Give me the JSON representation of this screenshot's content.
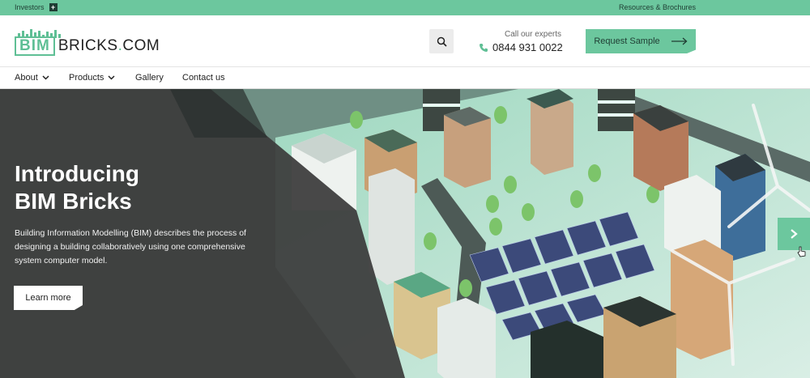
{
  "topbar": {
    "investors_label": "Investors",
    "resources_label": "Resources & Brochures"
  },
  "header": {
    "logo_bim": "BIM",
    "logo_bricks": "BRICKS",
    "logo_dot": ".",
    "logo_com": "COM",
    "call_label": "Call our experts",
    "phone": "0844 931 0022",
    "request_label": "Request Sample"
  },
  "nav": {
    "items": [
      {
        "label": "About",
        "has_dropdown": true
      },
      {
        "label": "Products",
        "has_dropdown": true
      },
      {
        "label": "Gallery",
        "has_dropdown": false
      },
      {
        "label": "Contact us",
        "has_dropdown": false
      }
    ]
  },
  "hero": {
    "title_line1": "Introducing",
    "title_line2": "BIM Bricks",
    "description": "Building Information Modelling (BIM) describes the process of designing a building collaboratively using one comprehensive system computer model.",
    "cta_label": "Learn more"
  },
  "colors": {
    "accent": "#6cc79e",
    "dark_text": "#1f3d33",
    "hero_overlay": "#3b3b3b"
  },
  "icons": {
    "search": "search-icon",
    "phone": "phone-icon",
    "arrow": "arrow-right-icon",
    "chevron_down": "chevron-down-icon",
    "chevron_right": "chevron-right-icon",
    "plus": "plus-icon"
  }
}
